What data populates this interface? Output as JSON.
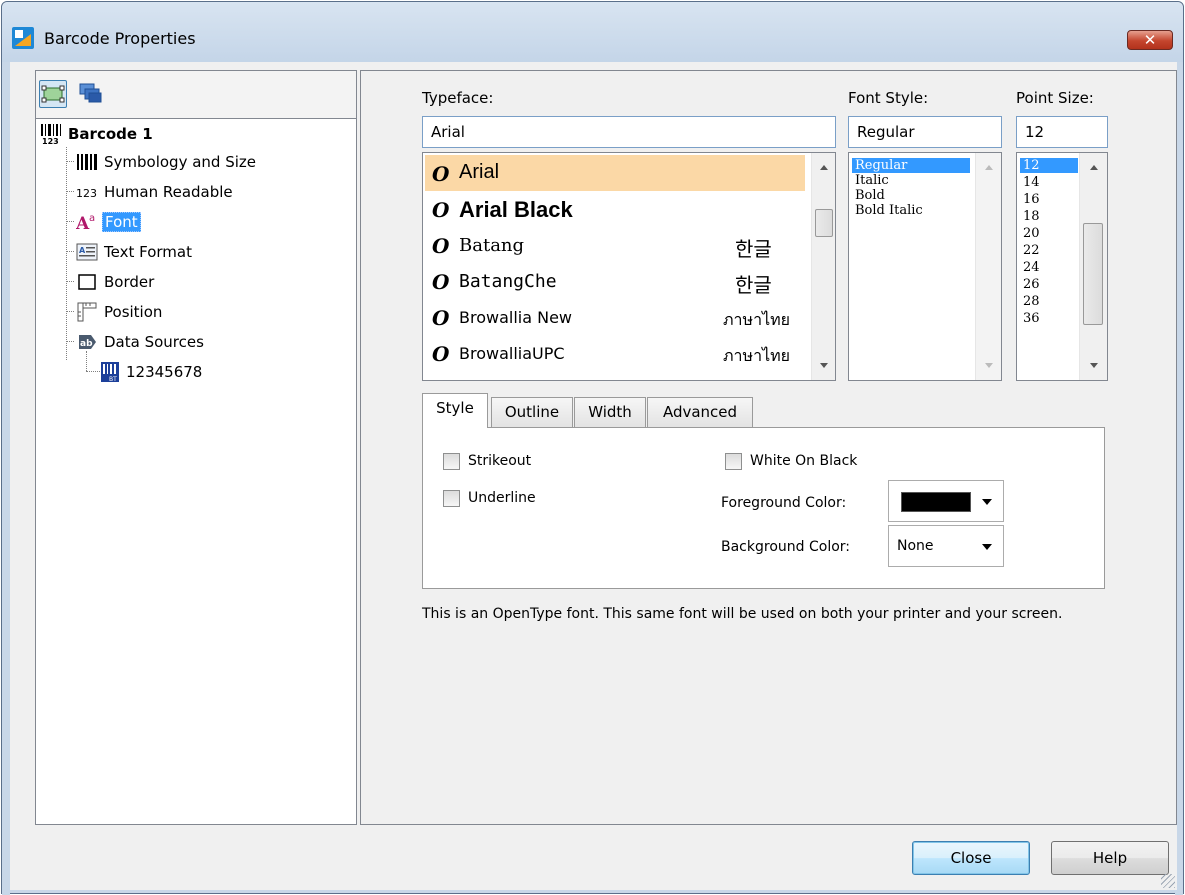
{
  "window": {
    "title": "Barcode Properties",
    "close_glyph": "✕",
    "app_icon": "app-icon"
  },
  "toolbar": {
    "icons": [
      "layout-icon",
      "layers-icon"
    ]
  },
  "tree": {
    "root": {
      "label": "Barcode 1",
      "icon": "barcode-icon"
    },
    "items": [
      {
        "label": "Symbology and Size",
        "icon": "barcode-bars-icon"
      },
      {
        "label": "Human Readable",
        "icon": "number-123-icon"
      },
      {
        "label": "Font",
        "icon": "font-icon",
        "selected": true
      },
      {
        "label": "Text Format",
        "icon": "text-format-icon"
      },
      {
        "label": "Border",
        "icon": "border-icon"
      },
      {
        "label": "Position",
        "icon": "position-icon"
      },
      {
        "label": "Data Sources",
        "icon": "data-source-icon"
      }
    ],
    "child": {
      "label": "12345678",
      "icon": "data-field-icon"
    }
  },
  "font": {
    "typeface_label": "Typeface:",
    "typeface_value": "Arial",
    "style_label": "Font Style:",
    "style_value": "Regular",
    "size_label": "Point Size:",
    "size_value": "12",
    "typefaces": [
      {
        "name": "Arial",
        "sample": ""
      },
      {
        "name": "Arial Black",
        "sample": ""
      },
      {
        "name": "Batang",
        "sample": "한글"
      },
      {
        "name": "BatangChe",
        "sample": "한글"
      },
      {
        "name": "Browallia New",
        "sample": "ภาษาไทย"
      },
      {
        "name": "BrowalliaUPC",
        "sample": "ภาษาไทย"
      }
    ],
    "type_glyph": "O",
    "styles": [
      "Regular",
      "Italic",
      "Bold",
      "Bold Italic"
    ],
    "sizes": [
      "12",
      "14",
      "16",
      "18",
      "20",
      "22",
      "24",
      "26",
      "28",
      "36"
    ],
    "selected_typeface": "Arial",
    "selected_style": "Regular",
    "selected_size": "12"
  },
  "tabs": [
    {
      "label": "Style",
      "active": true
    },
    {
      "label": "Outline",
      "active": false
    },
    {
      "label": "Width",
      "active": false
    },
    {
      "label": "Advanced",
      "active": false
    }
  ],
  "style_tab": {
    "strikeout_label": "Strikeout",
    "strikeout_checked": false,
    "underline_label": "Underline",
    "underline_checked": false,
    "white_on_black_label": "White On Black",
    "white_on_black_checked": false,
    "foreground_label": "Foreground Color:",
    "foreground_color": "#000000",
    "background_label": "Background Color:",
    "background_value": "None"
  },
  "info_text": "This is an OpenType font. This same font will be used on both your printer and your screen.",
  "buttons": {
    "close": "Close",
    "help": "Help"
  }
}
